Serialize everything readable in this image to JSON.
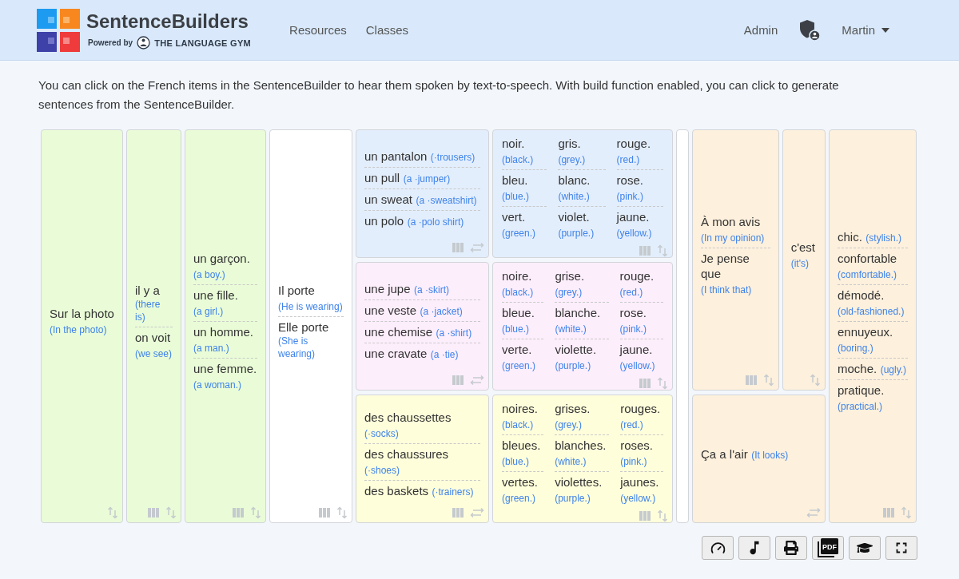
{
  "header": {
    "brand": "SentenceBuilders",
    "powered_by": "Powered by",
    "partner": "THE LANGUAGE GYM",
    "nav": [
      {
        "label": "Resources"
      },
      {
        "label": "Classes"
      }
    ],
    "admin": "Admin",
    "user": "Martin"
  },
  "intro": "You can click on the French items in the SentenceBuilder to hear them spoken by text-to-speech. With build function enabled, you can click to generate sentences from the SentenceBuilder.",
  "columns": [
    {
      "blocks": [
        {
          "kind": "list",
          "color": "#e9fcd7",
          "column_toggle": false,
          "swap_horizontal": false,
          "items": [
            {
              "text": "Sur la photo",
              "translation": "(In the photo)"
            }
          ]
        }
      ]
    },
    {
      "blocks": [
        {
          "kind": "list",
          "color": "#e9fcd7",
          "column_toggle": true,
          "swap_horizontal": false,
          "items": [
            {
              "text": "il y a",
              "translation": "(there is)"
            },
            {
              "text": "on voit",
              "translation": "(we see)"
            }
          ]
        }
      ]
    },
    {
      "blocks": [
        {
          "kind": "list",
          "color": "#e9fcd7",
          "column_toggle": true,
          "swap_horizontal": false,
          "items": [
            {
              "text": "un garçon.",
              "translation": "(a boy.)"
            },
            {
              "text": "une fille.",
              "translation": "(a girl.)"
            },
            {
              "text": "un homme.",
              "translation": "(a man.)"
            },
            {
              "text": "une femme.",
              "translation": "(a woman.)"
            }
          ]
        }
      ]
    },
    {
      "blocks": [
        {
          "kind": "list",
          "color": "#ffffff",
          "column_toggle": true,
          "swap_horizontal": false,
          "items": [
            {
              "text": "Il porte",
              "translation": "(He is wearing)"
            },
            {
              "text": "Elle porte",
              "translation": "(She is wearing)"
            }
          ]
        }
      ]
    },
    {
      "blocks": [
        {
          "kind": "list",
          "color": "#e3eefc",
          "column_toggle": true,
          "swap_horizontal": true,
          "items": [
            {
              "text": "un pantalon",
              "translation": "(·trousers)"
            },
            {
              "text": "un pull",
              "translation": "(a ·jumper)"
            },
            {
              "text": "un sweat",
              "translation": "(a ·sweatshirt)"
            },
            {
              "text": "un polo",
              "translation": "(a ·polo shirt)"
            }
          ]
        },
        {
          "kind": "list",
          "color": "#fdeefc",
          "column_toggle": true,
          "swap_horizontal": true,
          "items": [
            {
              "text": "une jupe",
              "translation": "(a ·skirt)"
            },
            {
              "text": "une veste",
              "translation": "(a ·jacket)"
            },
            {
              "text": "une chemise",
              "translation": "(a ·shirt)"
            },
            {
              "text": "une cravate",
              "translation": "(a ·tie)"
            }
          ]
        },
        {
          "kind": "list",
          "color": "#fefedb",
          "column_toggle": true,
          "swap_horizontal": true,
          "items": [
            {
              "text": "des chaussettes",
              "translation": "(·socks)"
            },
            {
              "text": "des chaussures",
              "translation": "(·shoes)"
            },
            {
              "text": "des baskets",
              "translation": "(·trainers)"
            }
          ]
        }
      ]
    },
    {
      "blocks": [
        {
          "kind": "grid",
          "color": "#e3eefc",
          "column_toggle": true,
          "swap_horizontal": false,
          "items": [
            {
              "text": "noir.",
              "translation": "(black.)"
            },
            {
              "text": "gris.",
              "translation": "(grey.)"
            },
            {
              "text": "rouge.",
              "translation": "(red.)"
            },
            {
              "text": "bleu.",
              "translation": "(blue.)"
            },
            {
              "text": "blanc.",
              "translation": "(white.)"
            },
            {
              "text": "rose.",
              "translation": "(pink.)"
            },
            {
              "text": "vert.",
              "translation": "(green.)"
            },
            {
              "text": "violet.",
              "translation": "(purple.)"
            },
            {
              "text": "jaune.",
              "translation": "(yellow.)"
            }
          ]
        },
        {
          "kind": "grid",
          "color": "#fdeefc",
          "column_toggle": true,
          "swap_horizontal": false,
          "items": [
            {
              "text": "noire.",
              "translation": "(black.)"
            },
            {
              "text": "grise.",
              "translation": "(grey.)"
            },
            {
              "text": "rouge.",
              "translation": "(red.)"
            },
            {
              "text": "bleue.",
              "translation": "(blue.)"
            },
            {
              "text": "blanche.",
              "translation": "(white.)"
            },
            {
              "text": "rose.",
              "translation": "(pink.)"
            },
            {
              "text": "verte.",
              "translation": "(green.)"
            },
            {
              "text": "violette.",
              "translation": "(purple.)"
            },
            {
              "text": "jaune.",
              "translation": "(yellow.)"
            }
          ]
        },
        {
          "kind": "grid",
          "color": "#fefedb",
          "column_toggle": true,
          "swap_horizontal": false,
          "items": [
            {
              "text": "noires.",
              "translation": "(black.)"
            },
            {
              "text": "grises.",
              "translation": "(grey.)"
            },
            {
              "text": "rouges.",
              "translation": "(red.)"
            },
            {
              "text": "bleues.",
              "translation": "(blue.)"
            },
            {
              "text": "blanches.",
              "translation": "(white.)"
            },
            {
              "text": "roses.",
              "translation": "(pink.)"
            },
            {
              "text": "vertes.",
              "translation": "(green.)"
            },
            {
              "text": "violettes.",
              "translation": "(purple.)"
            },
            {
              "text": "jaunes.",
              "translation": "(yellow.)"
            }
          ]
        }
      ]
    },
    {
      "blocks": [
        {
          "kind": "blank",
          "color": "#ffffff"
        }
      ]
    },
    {
      "blocks": [
        {
          "kind": "pair",
          "parts": [
            {
              "kind": "list",
              "color": "#fdf0dc",
              "column_toggle": true,
              "swap_horizontal": false,
              "items": [
                {
                  "text": "À mon avis",
                  "translation": "(In my opinion)"
                },
                {
                  "text": "Je pense que",
                  "translation": "(I think that)"
                }
              ]
            },
            {
              "kind": "list",
              "color": "#fdf0dc",
              "column_toggle": false,
              "swap_horizontal": false,
              "items": [
                {
                  "text": "c'est",
                  "translation": "(it's)"
                }
              ]
            }
          ]
        },
        {
          "kind": "list",
          "color": "#fdf0dc",
          "column_toggle": false,
          "swap_horizontal": true,
          "items": [
            {
              "text": "Ça a l'air",
              "translation": "(It looks)"
            }
          ]
        }
      ]
    },
    {
      "blocks": [
        {
          "kind": "list",
          "color": "#fdf0dc",
          "column_toggle": true,
          "swap_horizontal": false,
          "items": [
            {
              "text": "chic.",
              "translation": "(stylish.)"
            },
            {
              "text": "confortable",
              "translation": "(comfortable.)"
            },
            {
              "text": "démodé.",
              "translation": "(old-fashioned.)"
            },
            {
              "text": "ennuyeux.",
              "translation": "(boring.)"
            },
            {
              "text": "moche.",
              "translation": "(ugly.)"
            },
            {
              "text": "pratique.",
              "translation": "(practical.)"
            }
          ]
        }
      ]
    }
  ],
  "toolbar": {
    "pdf_label": "PDF"
  }
}
